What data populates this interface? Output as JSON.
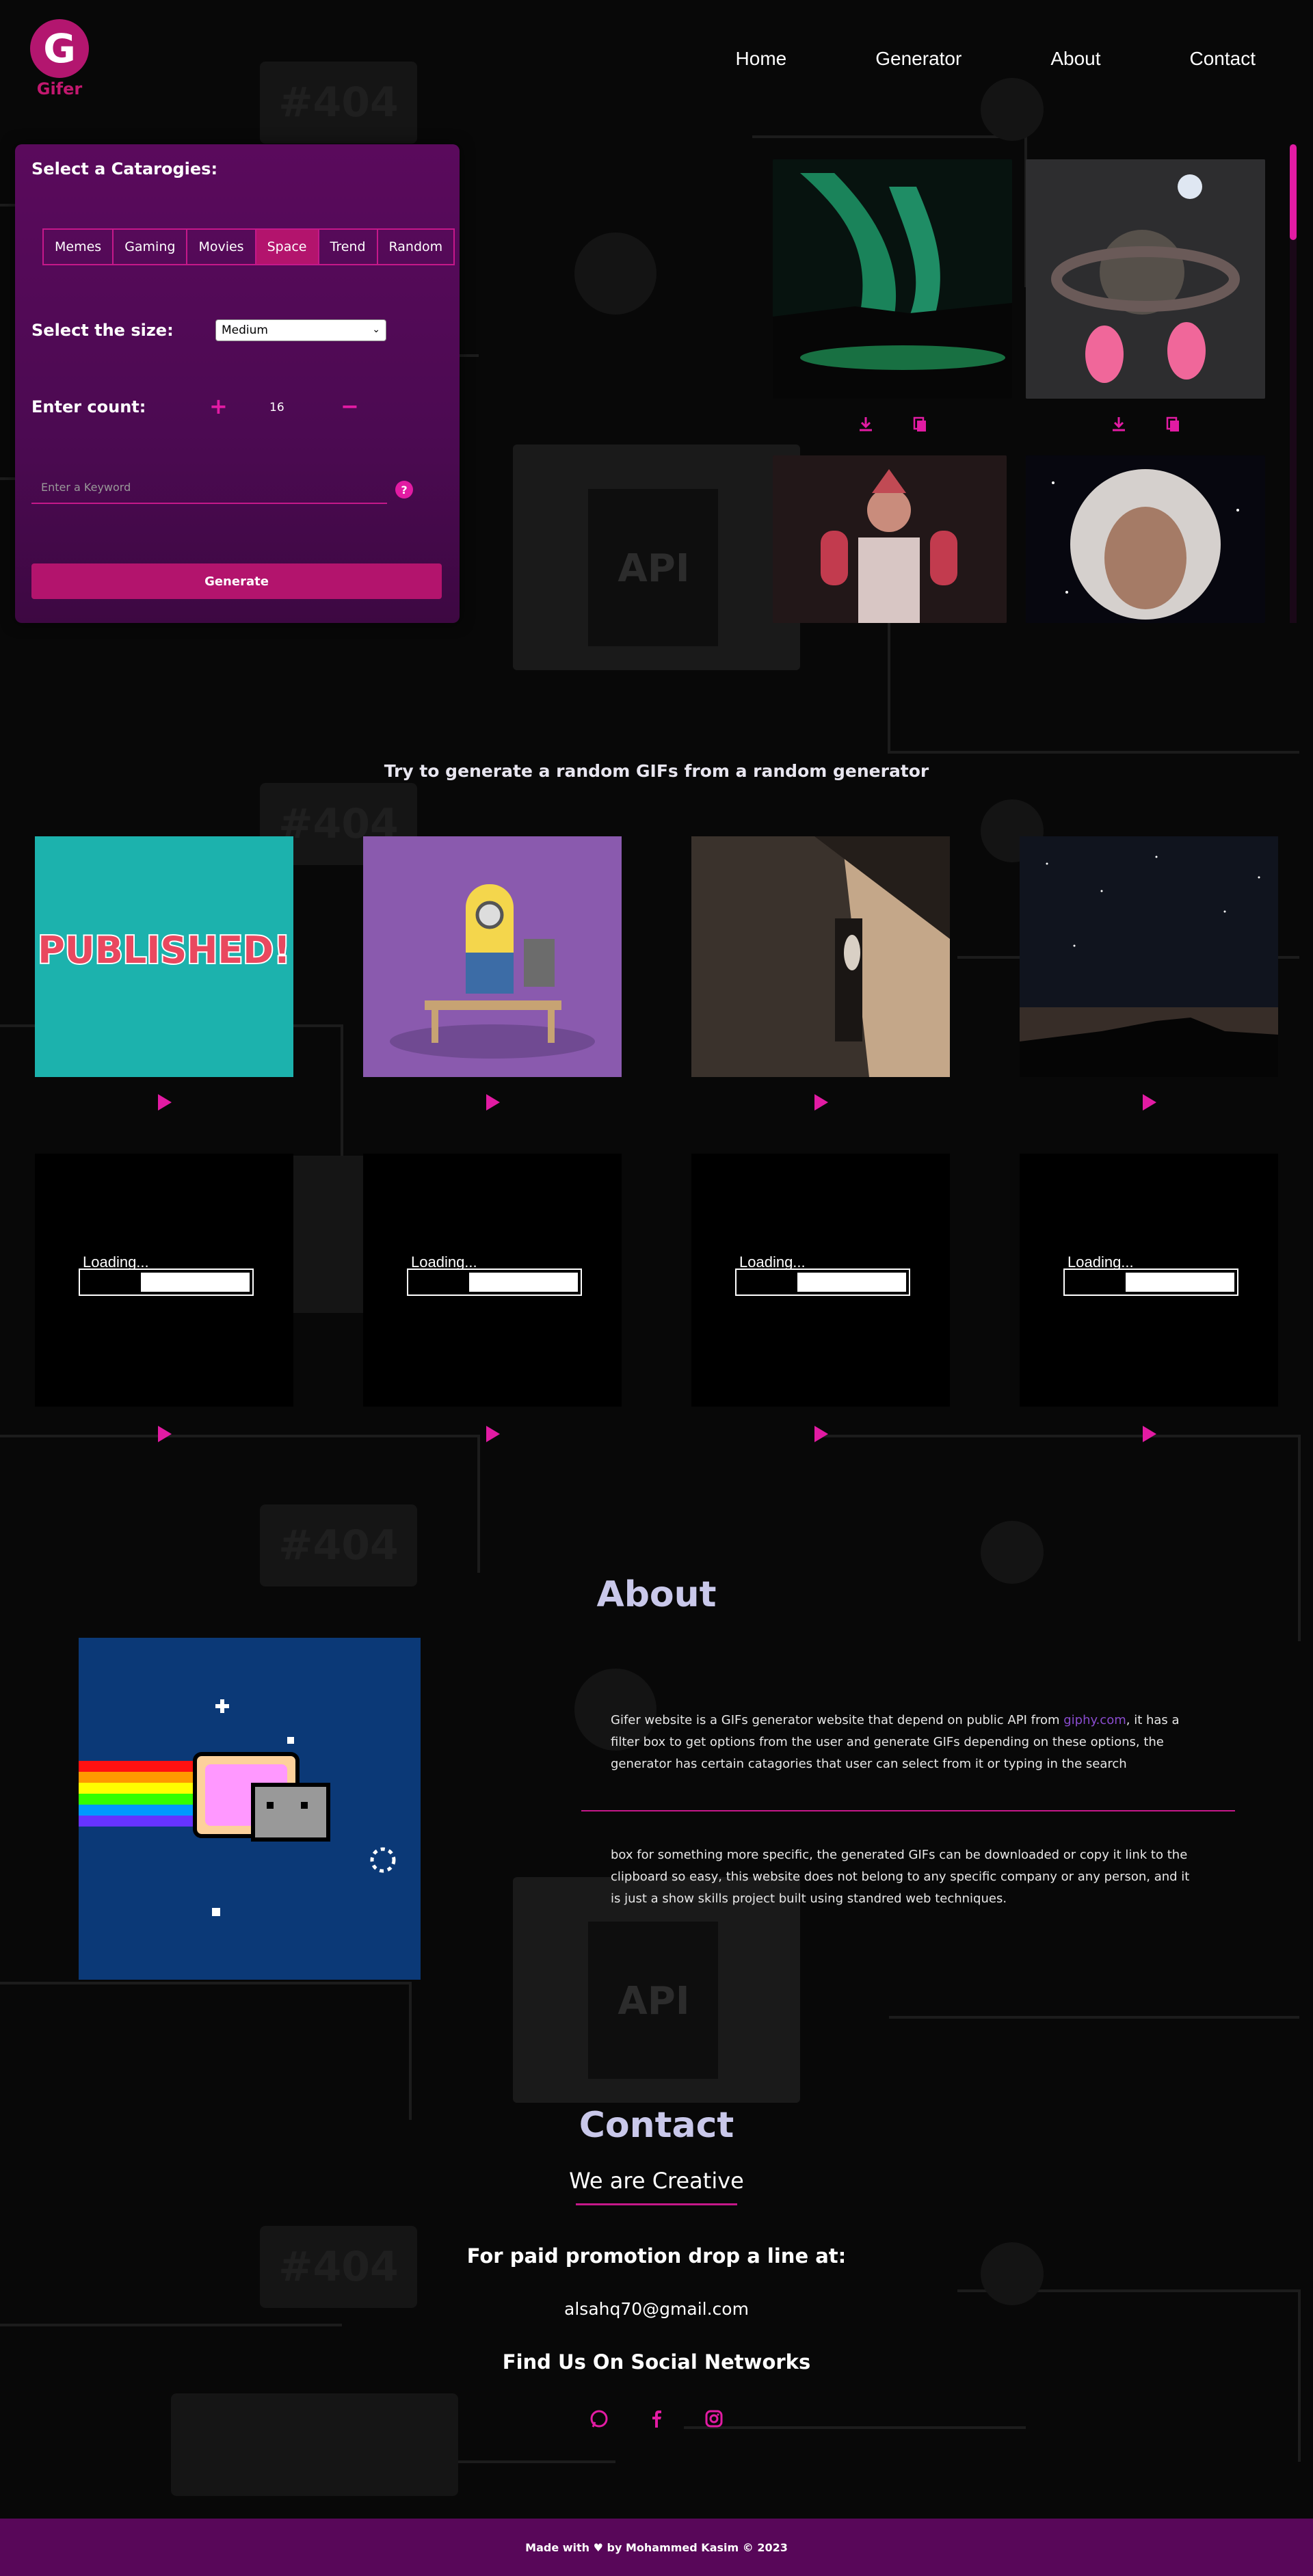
{
  "brand": {
    "logo_letter": "G",
    "name": "Gifer"
  },
  "nav": {
    "home": "Home",
    "generator": "Generator",
    "about": "About",
    "contact": "Contact"
  },
  "filters": {
    "categories_label": "Select a Catarogies:",
    "categories": [
      "Memes",
      "Gaming",
      "Movies",
      "Space",
      "Trend",
      "Random"
    ],
    "active_category": "Space",
    "size_label": "Select the size:",
    "size_value": "Medium",
    "count_label": "Enter count:",
    "count_value": "16",
    "plus_symbol": "+",
    "minus_symbol": "−",
    "keyword_placeholder": "Enter a Keyword",
    "help_symbol": "?",
    "generate_label": "Generate"
  },
  "random": {
    "headline": "Try to generate a random GIFs from a random generator",
    "published_text": "PUBLISHED!",
    "loading_text": "Loading...",
    "loading_progress": 0.35
  },
  "about": {
    "title": "About",
    "p1_before": "Gifer website is a GIFs generator website that depend on public API from ",
    "p1_link": "giphy.com",
    "p1_after": ", it has a filter box to get options from the user and generate GIFs depending on these options, the generator has certain catagories that user can select from it or typing in the search",
    "p2": "box for something more specific, the generated GIFs can be downloaded or copy it link to the clipboard so easy, this website does not belong to any specific company or any person, and it is just a show skills project built using standred web techniques."
  },
  "contact": {
    "title": "Contact",
    "subtitle": "We are Creative",
    "promo": "For paid promotion drop a line at:",
    "email": "alsahq70@gmail.com",
    "social_title": "Find Us On Social Networks",
    "icons": [
      "whatsapp-icon",
      "facebook-icon",
      "instagram-icon"
    ]
  },
  "footer": {
    "text": "Made with ♥ by Mohammed Kasim © 2023"
  },
  "colors": {
    "accent": "#e21ba3",
    "panel": "#5a0a5c",
    "footer": "#580759",
    "button": "#b3146d"
  }
}
